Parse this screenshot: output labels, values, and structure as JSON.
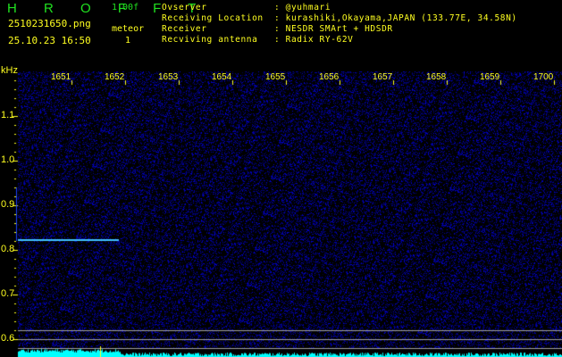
{
  "app": {
    "logo": "H R O F F T",
    "version": "1.00f"
  },
  "file": {
    "name": "2510231650.png",
    "datetime": "25.10.23 16:50"
  },
  "meteor": {
    "label": "meteor",
    "count": "1"
  },
  "info": [
    {
      "key": "Ovserver",
      "value": "@yuhmari"
    },
    {
      "key": "Receiving Location",
      "value": "kurashiki,Okayama,JAPAN (133.77E, 34.58N)"
    },
    {
      "key": "Receiver",
      "value": "NESDR SMArt + HDSDR"
    },
    {
      "key": "Recviving antenna",
      "value": "Radix RY-62V"
    }
  ],
  "axis": {
    "y_unit": "kHz",
    "x_ticks": [
      "1651",
      "1652",
      "1653",
      "1654",
      "1655",
      "1656",
      "1657",
      "1658",
      "1659",
      "1700"
    ],
    "y_ticks": [
      "1.1",
      "1.0",
      "0.9",
      "0.8",
      "0.7",
      "0.6"
    ]
  },
  "colors": {
    "text": "#ffff20",
    "logo": "#20e020",
    "meteor": "#40c0ff",
    "spectrum": "#00ffff"
  }
}
